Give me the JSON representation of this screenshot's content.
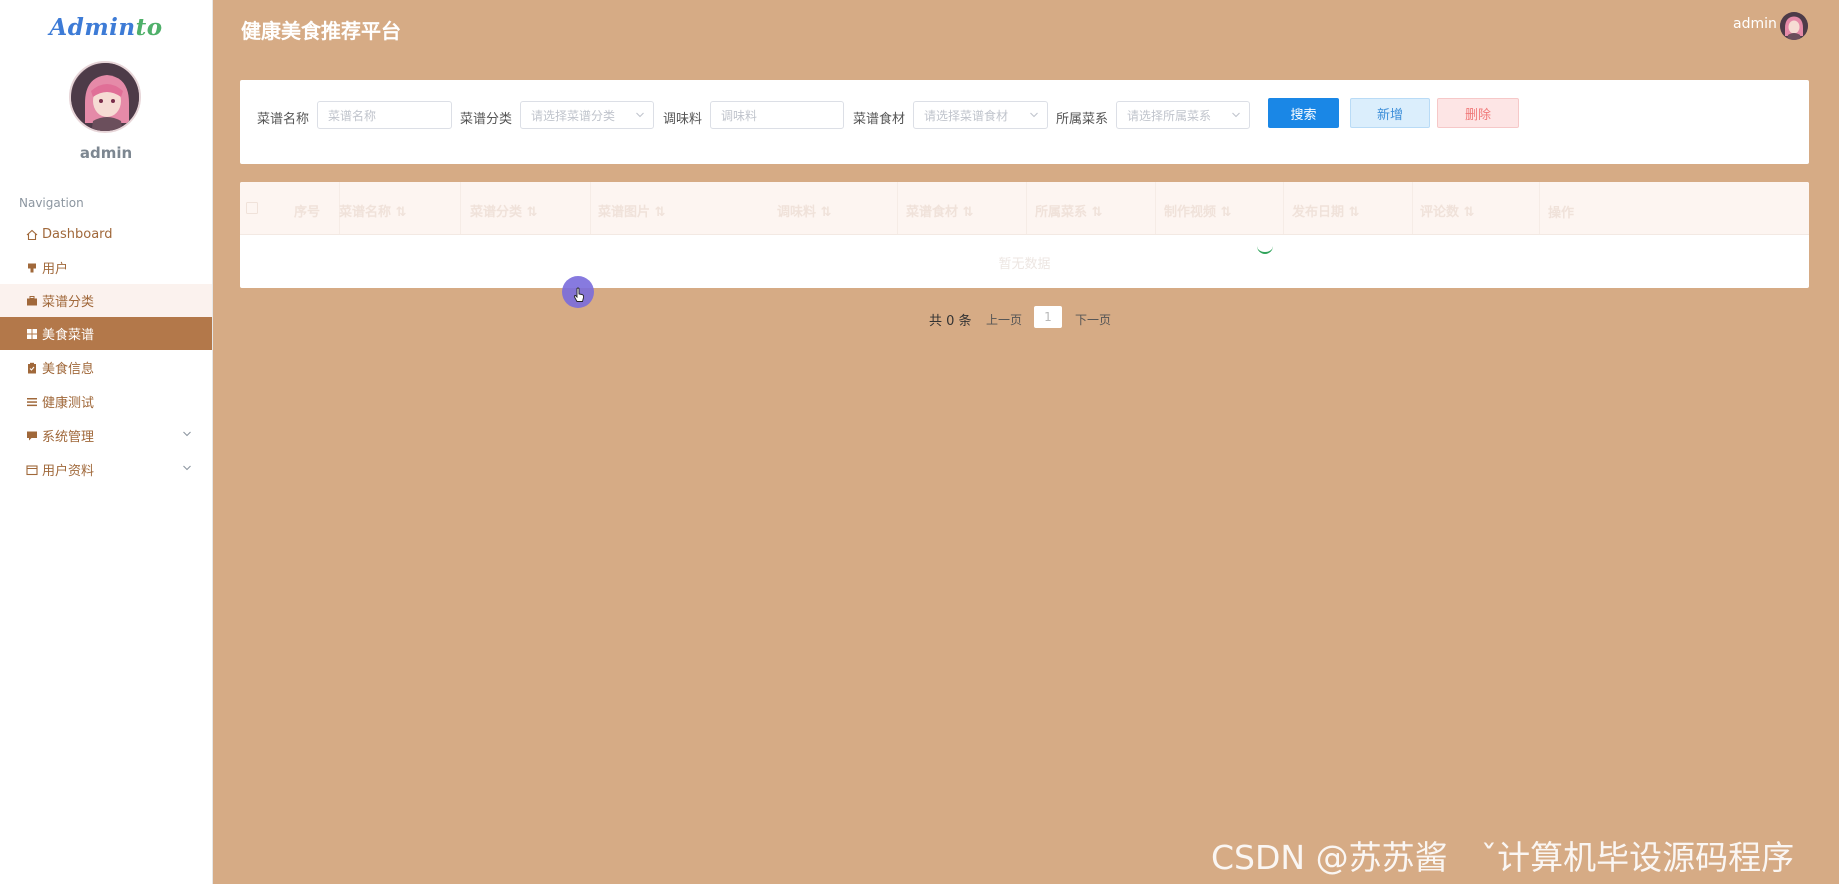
{
  "sidebar": {
    "logo_main": "Admin",
    "logo_accent": "to",
    "username": "admin",
    "nav_title": "Navigation",
    "items": [
      {
        "label": "Dashboard",
        "icon": "home-icon"
      },
      {
        "label": "用户",
        "icon": "user-icon"
      },
      {
        "label": "菜谱分类",
        "icon": "briefcase-icon"
      },
      {
        "label": "美食菜谱",
        "icon": "grid-icon"
      },
      {
        "label": "美食信息",
        "icon": "clipboard-icon"
      },
      {
        "label": "健康测试",
        "icon": "list-icon"
      },
      {
        "label": "系统管理",
        "icon": "chat-icon"
      },
      {
        "label": "用户资料",
        "icon": "card-icon"
      }
    ]
  },
  "header": {
    "title": "健康美食推荐平台",
    "user": "admin"
  },
  "search": {
    "name_label": "菜谱名称",
    "name_placeholder": "菜谱名称",
    "category_label": "菜谱分类",
    "category_placeholder": "请选择菜谱分类",
    "seasoning_label": "调味料",
    "seasoning_placeholder": "调味料",
    "ingredient_label": "菜谱食材",
    "ingredient_placeholder": "请选择菜谱食材",
    "cuisine_label": "所属菜系",
    "cuisine_placeholder": "请选择所属菜系",
    "search_button": "搜索",
    "add_button": "新增",
    "delete_button": "删除"
  },
  "table": {
    "columns": [
      "序号",
      "菜谱名称 ⇅",
      "菜谱分类 ⇅",
      "菜谱图片 ⇅",
      "调味料 ⇅",
      "菜谱食材 ⇅",
      "所属菜系 ⇅",
      "制作视频 ⇅",
      "发布日期 ⇅",
      "评论数 ⇅",
      "操作"
    ],
    "empty_text": "暂无数据"
  },
  "pagination": {
    "total": "共 0 条",
    "prev": "上一页",
    "page": "1",
    "next": "下一页"
  },
  "watermark": "CSDN @苏苏酱　ˇ计算机毕设源码程序",
  "colors": {
    "background": "#d6ab85",
    "active_nav": "#b3784a",
    "primary": "#1a87e6"
  }
}
